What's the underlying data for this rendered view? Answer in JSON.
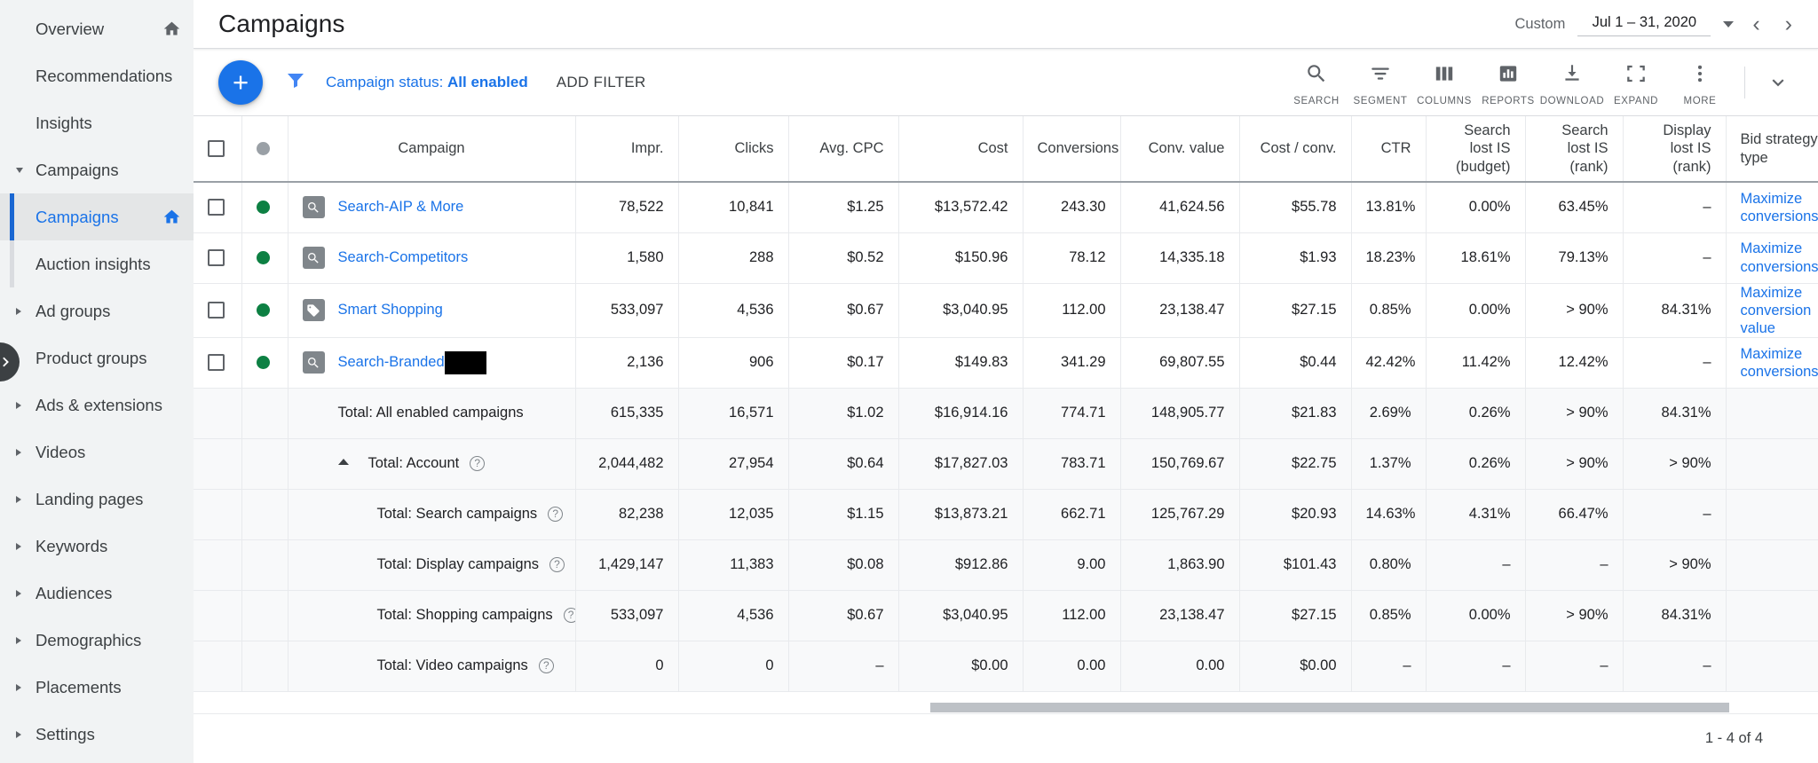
{
  "sidebar": {
    "items": [
      {
        "label": "Overview",
        "icon": "home-icon",
        "caret": "none",
        "state": "normal"
      },
      {
        "label": "Recommendations",
        "icon": "",
        "caret": "none",
        "state": "normal"
      },
      {
        "label": "Insights",
        "icon": "",
        "caret": "none",
        "state": "normal"
      },
      {
        "label": "Campaigns",
        "icon": "",
        "caret": "expanded",
        "state": "group"
      },
      {
        "label": "Campaigns",
        "icon": "home-icon",
        "caret": "none",
        "state": "active"
      },
      {
        "label": "Auction insights",
        "icon": "",
        "caret": "none",
        "state": "child"
      },
      {
        "label": "Ad groups",
        "icon": "",
        "caret": "collapsed",
        "state": "normal"
      },
      {
        "label": "Product groups",
        "icon": "",
        "caret": "none",
        "state": "normal"
      },
      {
        "label": "Ads & extensions",
        "icon": "",
        "caret": "collapsed",
        "state": "normal"
      },
      {
        "label": "Videos",
        "icon": "",
        "caret": "collapsed",
        "state": "normal"
      },
      {
        "label": "Landing pages",
        "icon": "",
        "caret": "collapsed",
        "state": "normal"
      },
      {
        "label": "Keywords",
        "icon": "",
        "caret": "collapsed",
        "state": "normal"
      },
      {
        "label": "Audiences",
        "icon": "",
        "caret": "collapsed",
        "state": "normal"
      },
      {
        "label": "Demographics",
        "icon": "",
        "caret": "collapsed",
        "state": "normal"
      },
      {
        "label": "Placements",
        "icon": "",
        "caret": "collapsed",
        "state": "normal"
      },
      {
        "label": "Settings",
        "icon": "",
        "caret": "collapsed",
        "state": "normal"
      }
    ],
    "collapse_icon": "chevron-right-icon"
  },
  "header": {
    "title": "Campaigns",
    "date_range": {
      "mode_label": "Custom",
      "value": "Jul 1 – 31, 2020",
      "dropdown_icon": "chevron-down-icon",
      "prev_icon": "chevron-left-icon",
      "next_icon": "chevron-right-icon"
    }
  },
  "toolbar": {
    "add_button": "+",
    "filter_icon": "funnel-icon",
    "filter_chip_prefix": "Campaign status: ",
    "filter_chip_value": "All enabled",
    "add_filter_label": "ADD FILTER",
    "tools": [
      {
        "label": "SEARCH",
        "icon": "search-icon"
      },
      {
        "label": "SEGMENT",
        "icon": "segment-icon"
      },
      {
        "label": "COLUMNS",
        "icon": "columns-icon"
      },
      {
        "label": "REPORTS",
        "icon": "reports-icon"
      },
      {
        "label": "DOWNLOAD",
        "icon": "download-icon"
      },
      {
        "label": "EXPAND",
        "icon": "expand-icon"
      },
      {
        "label": "MORE",
        "icon": "more-vert-icon"
      }
    ],
    "collapse_panel_icon": "chevron-down-icon"
  },
  "table": {
    "columns": [
      {
        "key": "campaign",
        "label": "Campaign",
        "align": "left"
      },
      {
        "key": "impr",
        "label": "Impr.",
        "align": "right"
      },
      {
        "key": "clicks",
        "label": "Clicks",
        "align": "right"
      },
      {
        "key": "avg_cpc",
        "label": "Avg. CPC",
        "align": "right"
      },
      {
        "key": "cost",
        "label": "Cost",
        "align": "right"
      },
      {
        "key": "conversions",
        "label": "Conversions",
        "align": "right"
      },
      {
        "key": "conv_value",
        "label": "Conv. value",
        "align": "right"
      },
      {
        "key": "cost_conv",
        "label": "Cost / conv.",
        "align": "right"
      },
      {
        "key": "ctr",
        "label": "CTR",
        "align": "right"
      },
      {
        "key": "lost_budget",
        "label": "Search lost IS (budget)",
        "align": "right"
      },
      {
        "key": "lost_rank",
        "label": "Search lost IS (rank)",
        "align": "right"
      },
      {
        "key": "disp_rank",
        "label": "Display lost IS (rank)",
        "align": "right"
      },
      {
        "key": "bid_type",
        "label": "Bid strategy type",
        "align": "left"
      }
    ],
    "header_status_dot": "status-dot-grey",
    "rows": [
      {
        "kind": "campaign",
        "status": "enabled",
        "type_icon": "search-campaign-icon",
        "name": "Search-AIP & More",
        "redacted": false,
        "impr": "78,522",
        "clicks": "10,841",
        "avg_cpc": "$1.25",
        "cost": "$13,572.42",
        "conversions": "243.30",
        "conv_value": "41,624.56",
        "cost_conv": "$55.78",
        "ctr": "13.81%",
        "lost_budget": "0.00%",
        "lost_rank": "63.45%",
        "disp_rank": "–",
        "bid_type": "Maximize conversions"
      },
      {
        "kind": "campaign",
        "status": "enabled",
        "type_icon": "search-campaign-icon",
        "name": "Search-Competitors",
        "redacted": false,
        "impr": "1,580",
        "clicks": "288",
        "avg_cpc": "$0.52",
        "cost": "$150.96",
        "conversions": "78.12",
        "conv_value": "14,335.18",
        "cost_conv": "$1.93",
        "ctr": "18.23%",
        "lost_budget": "18.61%",
        "lost_rank": "79.13%",
        "disp_rank": "–",
        "bid_type": "Maximize conversions"
      },
      {
        "kind": "campaign",
        "status": "enabled",
        "type_icon": "shopping-campaign-icon",
        "name": "Smart Shopping",
        "redacted": false,
        "impr": "533,097",
        "clicks": "4,536",
        "avg_cpc": "$0.67",
        "cost": "$3,040.95",
        "conversions": "112.00",
        "conv_value": "23,138.47",
        "cost_conv": "$27.15",
        "ctr": "0.85%",
        "lost_budget": "0.00%",
        "lost_rank": "> 90%",
        "disp_rank": "84.31%",
        "bid_type": "Maximize conversion value"
      },
      {
        "kind": "campaign",
        "status": "enabled",
        "type_icon": "search-campaign-icon",
        "name": "Search-Branded",
        "redacted": true,
        "impr": "2,136",
        "clicks": "906",
        "avg_cpc": "$0.17",
        "cost": "$149.83",
        "conversions": "341.29",
        "conv_value": "69,807.55",
        "cost_conv": "$0.44",
        "ctr": "42.42%",
        "lost_budget": "11.42%",
        "lost_rank": "12.42%",
        "disp_rank": "–",
        "bid_type": "Maximize conversions"
      },
      {
        "kind": "total",
        "indent": 1,
        "collapse": false,
        "help": false,
        "name": "Total: All enabled campaigns",
        "impr": "615,335",
        "clicks": "16,571",
        "avg_cpc": "$1.02",
        "cost": "$16,914.16",
        "conversions": "774.71",
        "conv_value": "148,905.77",
        "cost_conv": "$21.83",
        "ctr": "2.69%",
        "lost_budget": "0.26%",
        "lost_rank": "> 90%",
        "disp_rank": "84.31%",
        "bid_type": ""
      },
      {
        "kind": "total",
        "indent": 1,
        "collapse": true,
        "help": true,
        "name": "Total: Account",
        "impr": "2,044,482",
        "clicks": "27,954",
        "avg_cpc": "$0.64",
        "cost": "$17,827.03",
        "conversions": "783.71",
        "conv_value": "150,769.67",
        "cost_conv": "$22.75",
        "ctr": "1.37%",
        "lost_budget": "0.26%",
        "lost_rank": "> 90%",
        "disp_rank": "> 90%",
        "bid_type": ""
      },
      {
        "kind": "total",
        "indent": 2,
        "collapse": false,
        "help": true,
        "name": "Total: Search campaigns",
        "impr": "82,238",
        "clicks": "12,035",
        "avg_cpc": "$1.15",
        "cost": "$13,873.21",
        "conversions": "662.71",
        "conv_value": "125,767.29",
        "cost_conv": "$20.93",
        "ctr": "14.63%",
        "lost_budget": "4.31%",
        "lost_rank": "66.47%",
        "disp_rank": "–",
        "bid_type": ""
      },
      {
        "kind": "total",
        "indent": 2,
        "collapse": false,
        "help": true,
        "name": "Total: Display campaigns",
        "impr": "1,429,147",
        "clicks": "11,383",
        "avg_cpc": "$0.08",
        "cost": "$912.86",
        "conversions": "9.00",
        "conv_value": "1,863.90",
        "cost_conv": "$101.43",
        "ctr": "0.80%",
        "lost_budget": "–",
        "lost_rank": "–",
        "disp_rank": "> 90%",
        "bid_type": ""
      },
      {
        "kind": "total",
        "indent": 2,
        "collapse": false,
        "help": true,
        "name": "Total: Shopping campaigns",
        "impr": "533,097",
        "clicks": "4,536",
        "avg_cpc": "$0.67",
        "cost": "$3,040.95",
        "conversions": "112.00",
        "conv_value": "23,138.47",
        "cost_conv": "$27.15",
        "ctr": "0.85%",
        "lost_budget": "0.00%",
        "lost_rank": "> 90%",
        "disp_rank": "84.31%",
        "bid_type": ""
      },
      {
        "kind": "total",
        "indent": 2,
        "collapse": false,
        "help": true,
        "name": "Total: Video campaigns",
        "impr": "0",
        "clicks": "0",
        "avg_cpc": "–",
        "cost": "$0.00",
        "conversions": "0.00",
        "conv_value": "0.00",
        "cost_conv": "$0.00",
        "ctr": "–",
        "lost_budget": "–",
        "lost_rank": "–",
        "disp_rank": "–",
        "bid_type": ""
      }
    ]
  },
  "footer": {
    "pagination": "1 - 4 of 4"
  },
  "colors": {
    "accent": "#1a73e8",
    "status_enabled": "#0d8043",
    "sidebar_bg": "#f1f3f4",
    "total_row_bg": "#f8f9fa"
  }
}
